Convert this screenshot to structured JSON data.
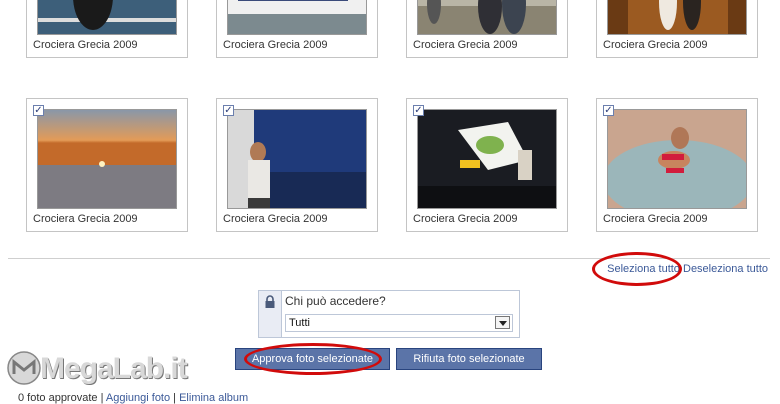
{
  "photos": [
    {
      "caption": "Crociera Grecia 2009",
      "checked": false
    },
    {
      "caption": "Crociera Grecia 2009",
      "checked": false
    },
    {
      "caption": "Crociera Grecia 2009",
      "checked": false
    },
    {
      "caption": "Crociera Grecia 2009",
      "checked": false
    },
    {
      "caption": "Crociera Grecia 2009",
      "checked": true
    },
    {
      "caption": "Crociera Grecia 2009",
      "checked": true
    },
    {
      "caption": "Crociera Grecia 2009",
      "checked": true
    },
    {
      "caption": "Crociera Grecia 2009",
      "checked": true
    }
  ],
  "checkbox_glyph": "✓",
  "selection": {
    "select_all": "Seleziona tutto",
    "deselect_all": "Deseleziona tutto"
  },
  "privacy": {
    "label": "Chi può accedere?",
    "selected": "Tutti",
    "icon": "lock-icon"
  },
  "actions": {
    "approve": "Approva foto selezionate",
    "reject": "Rifiuta foto selezionate"
  },
  "footer": {
    "status": "0 foto approvate",
    "sep": "|",
    "add_photos": "Aggiungi foto",
    "delete_album": "Elimina album"
  },
  "watermark": {
    "text": "MegaLab.it"
  },
  "colors": {
    "link": "#3b5998",
    "button": "#5b74a8",
    "annotation_ring": "#d10b0b"
  }
}
